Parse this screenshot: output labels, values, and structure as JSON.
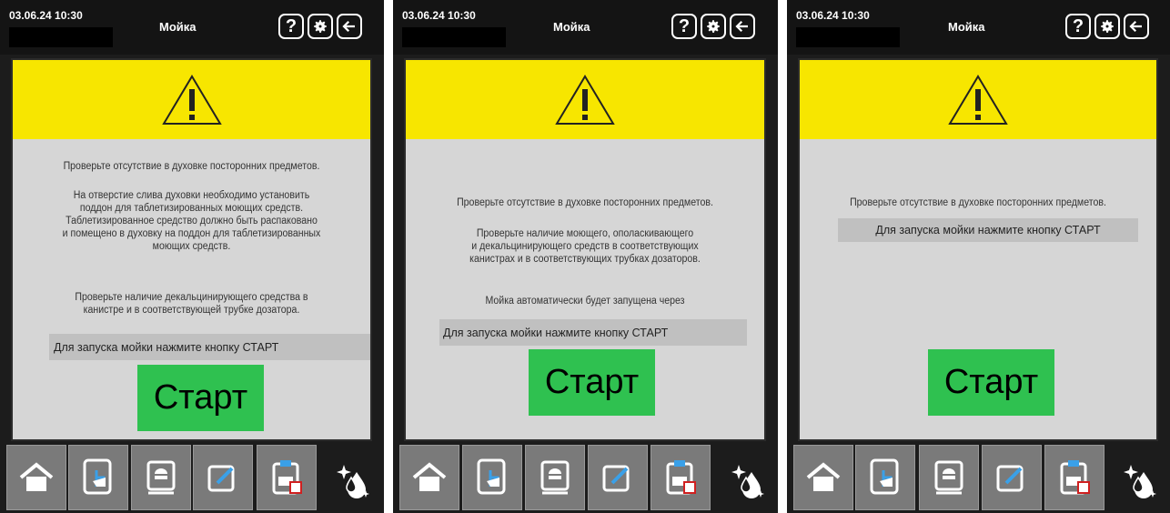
{
  "screens": [
    {
      "datetime": "03.06.24  10:30",
      "title": "Мойка",
      "paragraphs": [
        "Проверьте отсутствие в духовке посторонних предметов.",
        "На отверстие слива духовки необходимо установить\nподдон для таблетизированных моющих средств.\nТаблетизированное средство должно быть распаковано\nи помещено в духовку на поддон для таблетизированных\nмоющих средств.",
        "Проверьте наличие декальцинирующего средства в\nканистре и в соответствующей трубке дозатора."
      ],
      "prompt": "Для запуска мойки нажмите кнопку СТАРТ",
      "start_label": "Старт"
    },
    {
      "datetime": "03.06.24  10:30",
      "title": "Мойка",
      "paragraphs": [
        "Проверьте отсутствие в духовке посторонних предметов.",
        "Проверьте наличие моющего, ополаскивающего\nи декальцинирующего средств в соответствующих\nканистрах и в соответствующих трубках дозаторов.",
        "Мойка автоматически будет запущена через"
      ],
      "prompt": "Для запуска мойки нажмите кнопку СТАРТ",
      "start_label": "Старт"
    },
    {
      "datetime": "03.06.24  10:30",
      "title": "Мойка",
      "paragraphs": [
        "Проверьте отсутствие в духовке посторонних предметов."
      ],
      "prompt": "Для запуска мойки нажмите кнопку СТАРТ",
      "start_label": "Старт"
    }
  ],
  "toolbar_icons": [
    "help-icon",
    "settings-icon",
    "back-arrow-icon"
  ],
  "nav_icons": [
    "home-icon",
    "touch-program-icon",
    "recipe-book-icon",
    "edit-icon",
    "cleaning-checklist-icon",
    "wash-drops-icon"
  ],
  "colors": {
    "warning_yellow": "#f7e600",
    "start_green": "#2fc150",
    "panel_bg": "#d6d6d6",
    "frame_dark": "#1c1c1c"
  }
}
